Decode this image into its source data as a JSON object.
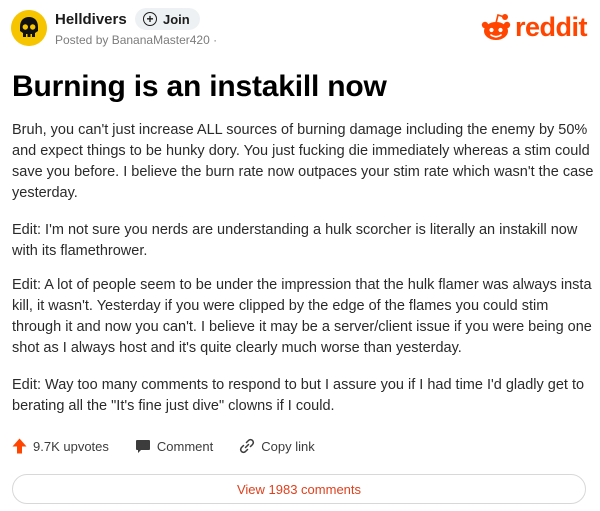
{
  "header": {
    "subreddit": "Helldivers",
    "join_label": "Join",
    "byline": "Posted by BananaMaster420 ·",
    "logo_text": "reddit",
    "brand_color": "#ff4500"
  },
  "post": {
    "title": "Burning is an instakill now",
    "paragraphs": [
      "Bruh, you can't just increase ALL sources of burning damage including the enemy by 50% and expect things to be hunky dory. You just fucking die immediately whereas a stim could save you before. I believe the burn rate now outpaces your stim rate which wasn't the case yesterday.",
      "Edit: I'm not sure you nerds are understanding a hulk scorcher is literally an instakill now with its flamethrower.",
      "Edit: A lot of people seem to be under the impression that the hulk flamer was always insta kill, it wasn't. Yesterday if you were clipped by the edge of the flames you could stim through it and now you can't. I believe it may be a server/client issue if you were being one shot as I always host and it's quite clearly much worse than yesterday.",
      "Edit: Way too many comments to respond to but I assure you if I had time I'd gladly get to berating all the \"It's fine just dive\" clowns if I could."
    ]
  },
  "actions": {
    "upvotes": "9.7K upvotes",
    "comment": "Comment",
    "copy_link": "Copy link",
    "upvote_color": "#ff4500"
  },
  "footer": {
    "view_comments": "View 1983 comments"
  }
}
